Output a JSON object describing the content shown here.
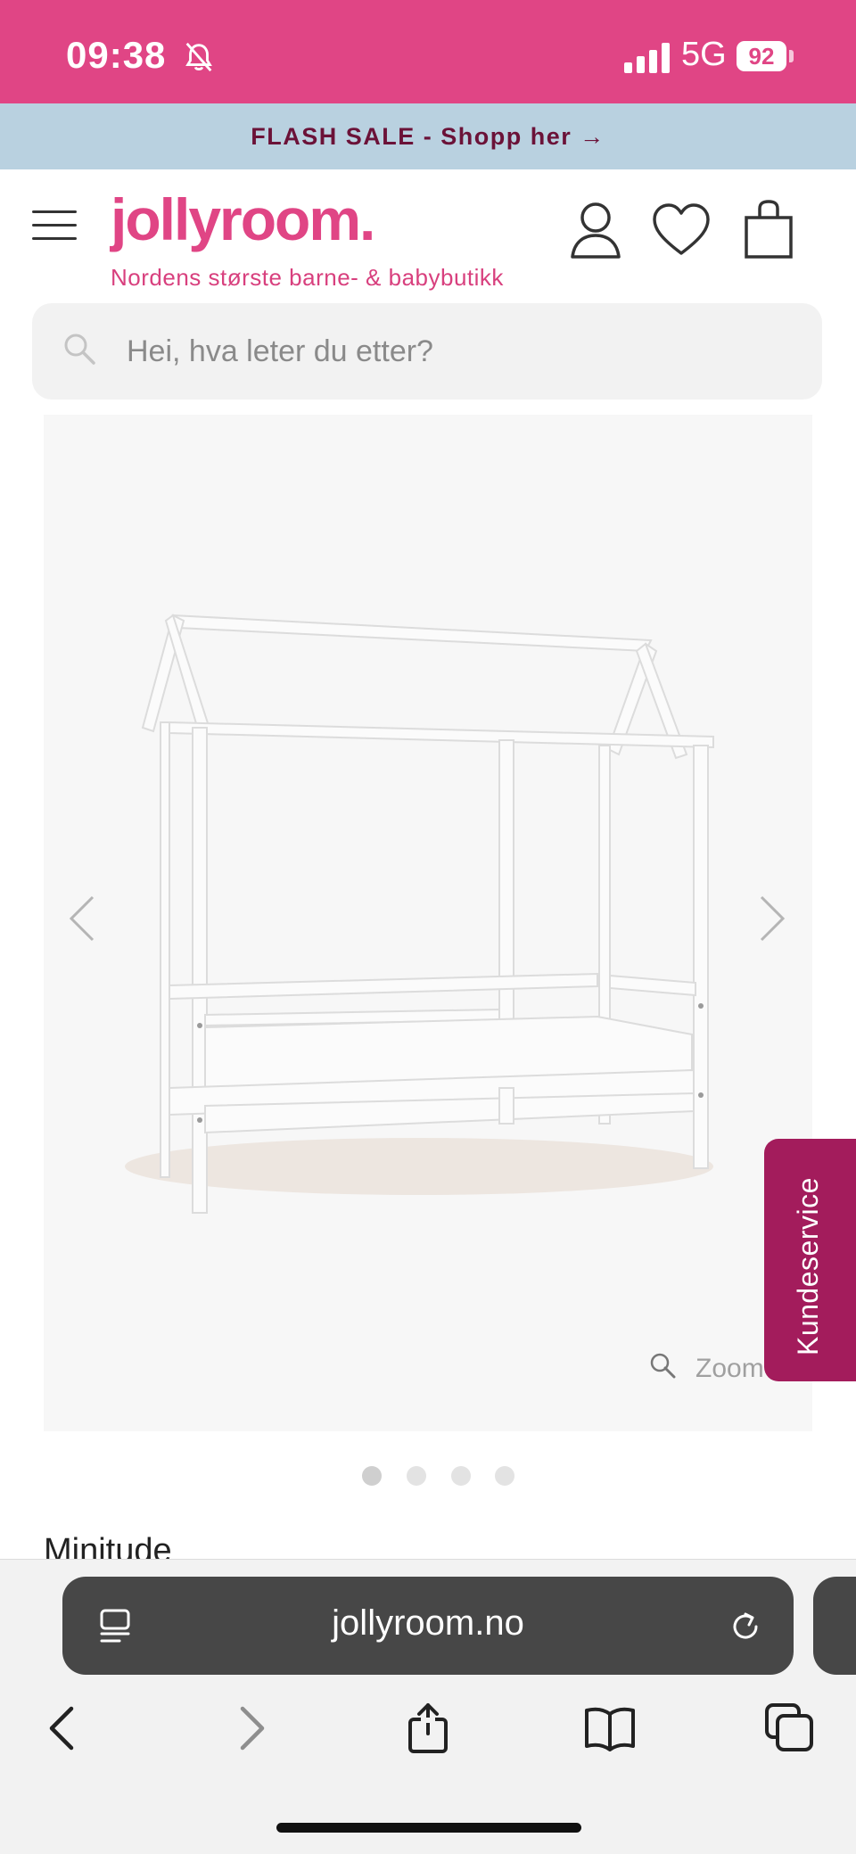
{
  "status_bar": {
    "time": "09:38",
    "network": "5G",
    "battery": "92"
  },
  "banner": {
    "text": "FLASH SALE - Shopp her →"
  },
  "header": {
    "logo": "jollyroom.",
    "tagline": "Nordens største barne- & babybutikk"
  },
  "search": {
    "placeholder": "Hei, hva leter du etter?"
  },
  "gallery": {
    "zoom_label": "Zoom",
    "slide_count": 4,
    "active_slide": 1
  },
  "support": {
    "label": "Kundeservice"
  },
  "product": {
    "name": "Minitude"
  },
  "browser": {
    "url": "jollyroom.no"
  },
  "colors": {
    "brand_pink": "#e04585",
    "banner_blue": "#b9d1e0",
    "support_magenta": "#a31c5c"
  }
}
